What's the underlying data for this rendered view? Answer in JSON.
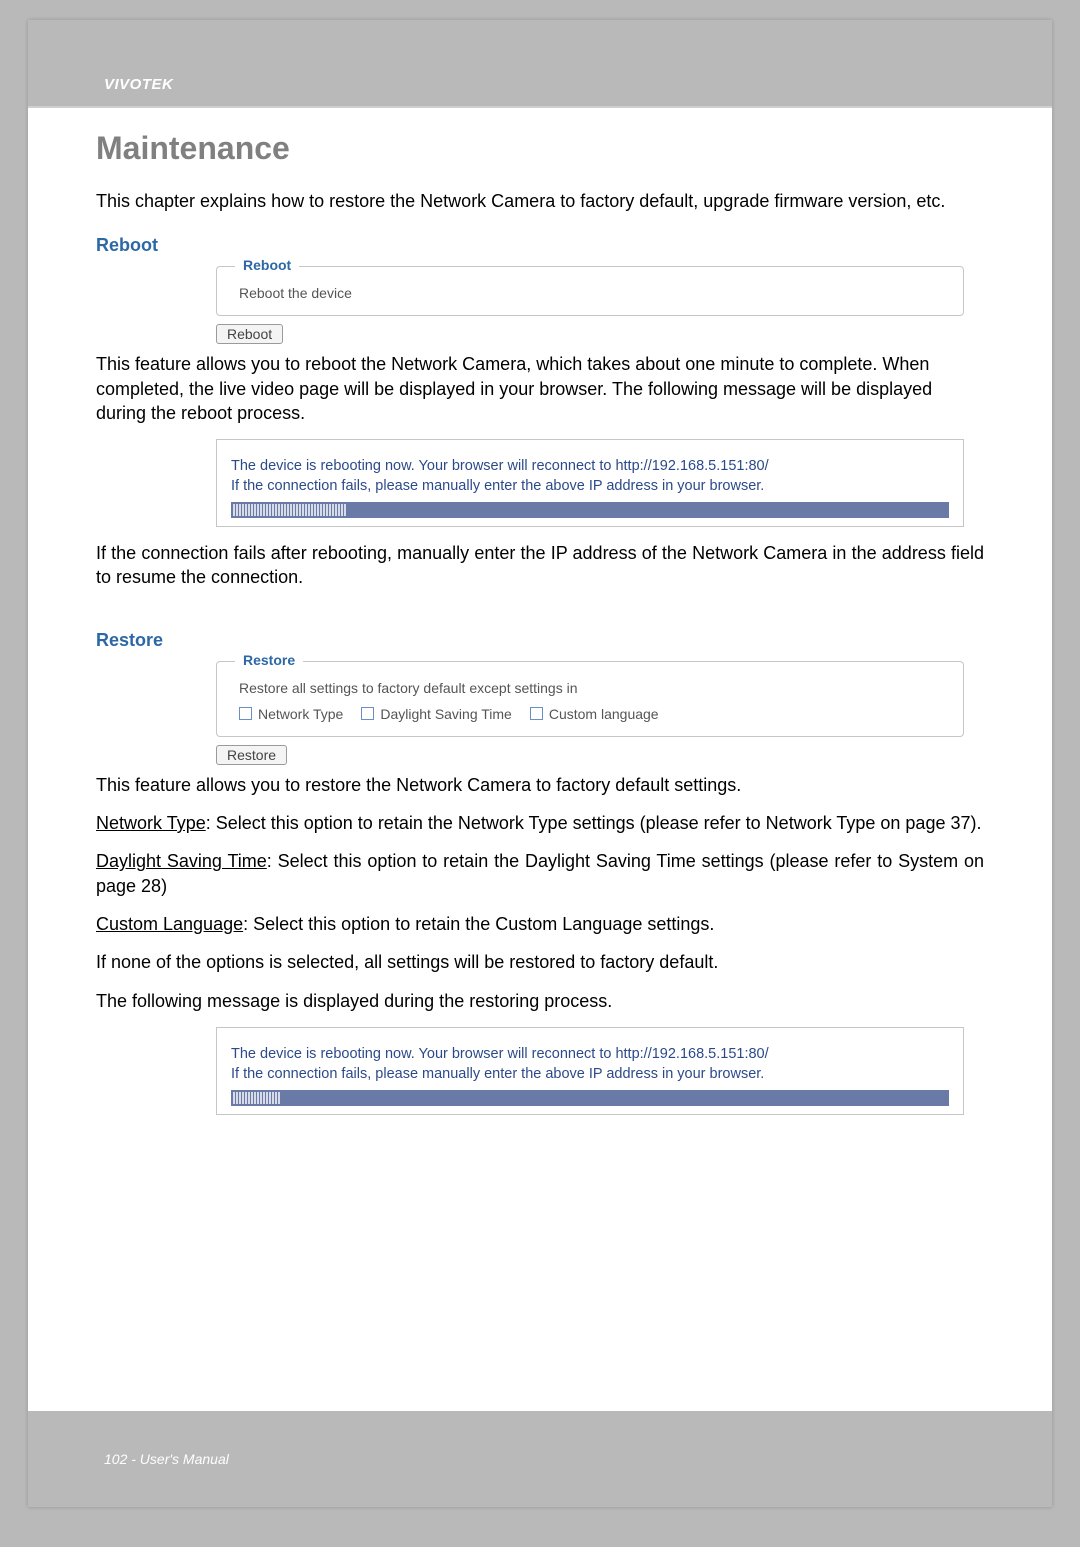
{
  "header": {
    "brand": "VIVOTEK"
  },
  "title": "Maintenance",
  "intro": "This chapter explains how to restore the Network Camera to factory default, upgrade firmware version, etc.",
  "reboot": {
    "heading": "Reboot",
    "legend": "Reboot",
    "text": "Reboot the device",
    "button": "Reboot",
    "desc": "This feature allows you to reboot the Network Camera, which takes about one minute to complete. When completed, the live video page will be displayed in your browser. The following message will be displayed during the reboot process.",
    "msg1": "The device is rebooting now. Your browser will reconnect to http://192.168.5.151:80/",
    "msg2": "If the connection fails, please manually enter the above IP address in your browser.",
    "after": "If the connection fails after rebooting, manually enter the IP address of the Network Camera in the address field to resume the connection."
  },
  "restore": {
    "heading": "Restore",
    "legend": "Restore",
    "text": "Restore all settings to factory default except settings in",
    "options": {
      "network": "Network Type",
      "dst": "Daylight Saving Time",
      "lang": "Custom language"
    },
    "button": "Restore",
    "desc": "This feature allows you to restore the Network Camera to factory default settings.",
    "net_label": "Network Type",
    "net_text": ": Select this option to retain the Network Type settings (please refer to Network Type on page 37).",
    "dst_label": "Daylight Saving Time",
    "dst_text": ": Select this option to retain the Daylight Saving Time settings (please refer to System on page 28)",
    "lang_label": "Custom Language",
    "lang_text": ": Select this option to retain the Custom Language settings.",
    "none": "If none of the options is selected, all settings will be restored to factory default.",
    "following": "The following message is displayed during the restoring process.",
    "msg1": "The device is rebooting now. Your browser will reconnect to http://192.168.5.151:80/",
    "msg2": "If the connection fails, please manually enter the above IP address in your browser."
  },
  "footer": "102 - User's Manual"
}
